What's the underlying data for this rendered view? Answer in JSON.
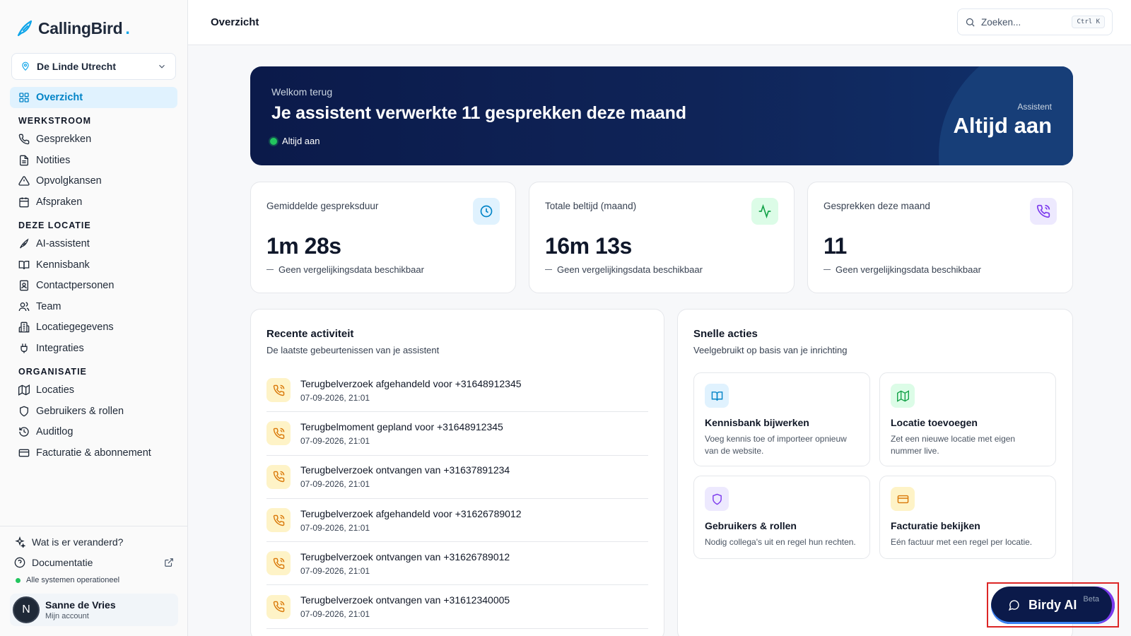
{
  "brand": {
    "name": "CallingBird",
    "accent": "#0ea5e9"
  },
  "location_selector": {
    "value": "De Linde Utrecht"
  },
  "nav": {
    "overview": "Overzicht",
    "sections": [
      {
        "title": "WERKSTROOM",
        "items": [
          "Gesprekken",
          "Notities",
          "Opvolgkansen",
          "Afspraken"
        ]
      },
      {
        "title": "DEZE LOCATIE",
        "items": [
          "AI-assistent",
          "Kennisbank",
          "Contactpersonen",
          "Team",
          "Locatiegegevens",
          "Integraties"
        ]
      },
      {
        "title": "ORGANISATIE",
        "items": [
          "Locaties",
          "Gebruikers & rollen",
          "Auditlog",
          "Facturatie & abonnement"
        ]
      }
    ]
  },
  "sidebar_bottom": {
    "whats_new": "Wat is er veranderd?",
    "docs": "Documentatie",
    "status": "Alle systemen operationeel",
    "account_initial": "N",
    "account_name": "Sanne de Vries",
    "account_sub": "Mijn account"
  },
  "header": {
    "title": "Overzicht",
    "search_placeholder": "Zoeken...",
    "search_shortcut": "Ctrl K"
  },
  "hero": {
    "welcome": "Welkom terug",
    "title": "Je assistent verwerkte 11 gesprekken deze maand",
    "status": "Altijd aan",
    "right_label": "Assistent",
    "right_value": "Altijd aan"
  },
  "stats": [
    {
      "label": "Gemiddelde gespreksduur",
      "value": "1m 28s",
      "note": "Geen vergelijkingsdata beschikbaar",
      "icon": "clock-icon",
      "icon_bg": "#e0f2fe",
      "icon_color": "#0284c7"
    },
    {
      "label": "Totale beltijd (maand)",
      "value": "16m 13s",
      "note": "Geen vergelijkingsdata beschikbaar",
      "icon": "activity-icon",
      "icon_bg": "#dcfce7",
      "icon_color": "#16a34a"
    },
    {
      "label": "Gesprekken deze maand",
      "value": "11",
      "note": "Geen vergelijkingsdata beschikbaar",
      "icon": "phone-call-icon",
      "icon_bg": "#ede9fe",
      "icon_color": "#7c3aed"
    }
  ],
  "activity": {
    "title": "Recente activiteit",
    "subtitle": "De laatste gebeurtenissen van je assistent",
    "items": [
      {
        "title": "Terugbelverzoek afgehandeld voor +31648912345",
        "time": "07-09-2026, 21:01"
      },
      {
        "title": "Terugbelmoment gepland voor +31648912345",
        "time": "07-09-2026, 21:01"
      },
      {
        "title": "Terugbelverzoek ontvangen van +31637891234",
        "time": "07-09-2026, 21:01"
      },
      {
        "title": "Terugbelverzoek afgehandeld voor +31626789012",
        "time": "07-09-2026, 21:01"
      },
      {
        "title": "Terugbelverzoek ontvangen van +31626789012",
        "time": "07-09-2026, 21:01"
      },
      {
        "title": "Terugbelverzoek ontvangen van +31612340005",
        "time": "07-09-2026, 21:01"
      }
    ]
  },
  "quick_actions": {
    "title": "Snelle acties",
    "subtitle": "Veelgebruikt op basis van je inrichting",
    "items": [
      {
        "title": "Kennisbank bijwerken",
        "desc": "Voeg kennis toe of importeer opnieuw van de website.",
        "icon": "book-open-icon",
        "icon_bg": "#e0f2fe",
        "icon_color": "#0284c7"
      },
      {
        "title": "Locatie toevoegen",
        "desc": "Zet een nieuwe locatie met eigen nummer live.",
        "icon": "map-icon",
        "icon_bg": "#dcfce7",
        "icon_color": "#16a34a"
      },
      {
        "title": "Gebruikers & rollen",
        "desc": "Nodig collega's uit en regel hun rechten.",
        "icon": "shield-icon",
        "icon_bg": "#ede9fe",
        "icon_color": "#7c3aed"
      },
      {
        "title": "Facturatie bekijken",
        "desc": "Eén factuur met een regel per locatie.",
        "icon": "credit-card-icon",
        "icon_bg": "#fef3c7",
        "icon_color": "#d97706"
      }
    ]
  },
  "birdy": {
    "label": "Birdy AI",
    "badge": "Beta"
  }
}
